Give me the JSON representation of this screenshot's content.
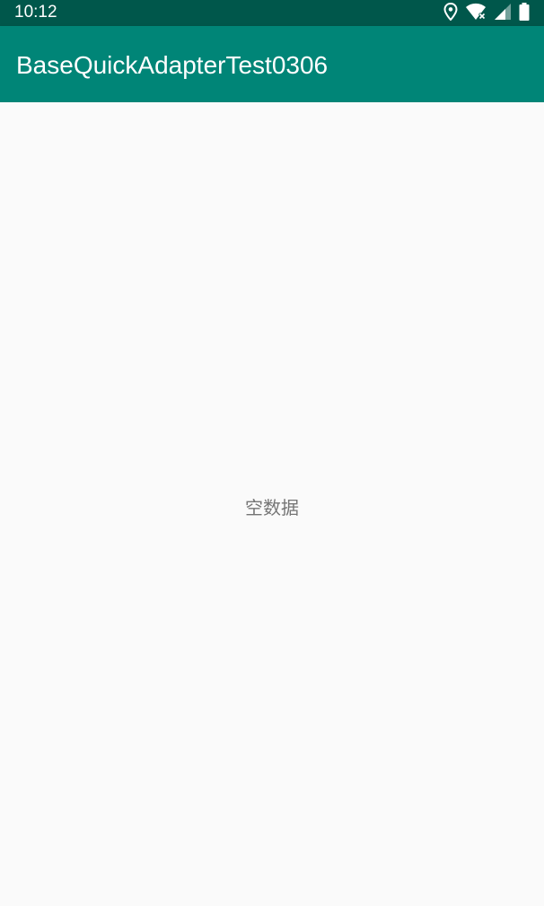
{
  "status_bar": {
    "time": "10:12",
    "icons": [
      "location-icon",
      "wifi-icon",
      "signal-icon",
      "battery-icon"
    ]
  },
  "app_bar": {
    "title": "BaseQuickAdapterTest0306"
  },
  "content": {
    "empty_text": "空数据"
  },
  "colors": {
    "status_bar": "#00574b",
    "app_bar": "#008577",
    "background": "#fafafa",
    "empty_text": "#757575"
  }
}
